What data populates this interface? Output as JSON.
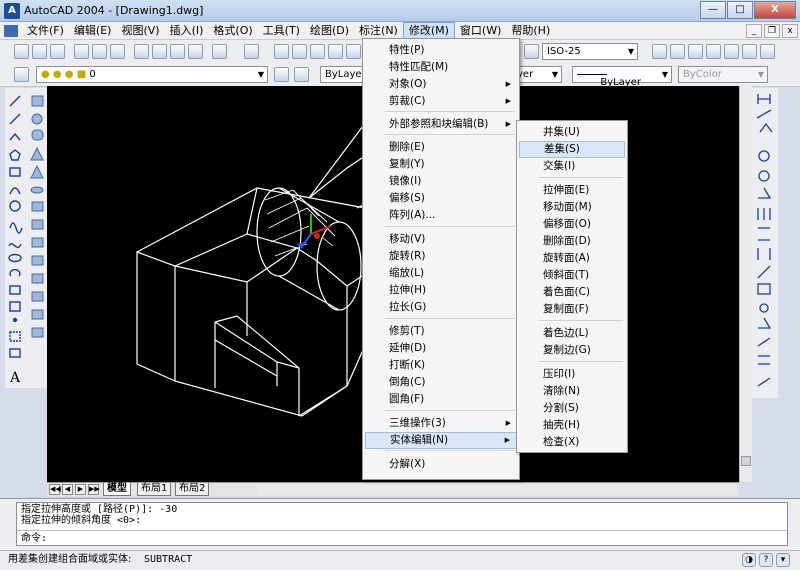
{
  "window": {
    "title": "AutoCAD 2004 - [Drawing1.dwg]",
    "app_icon": "autocad-icon",
    "minimize": "—",
    "maximize": "□",
    "close": "X"
  },
  "menubar": {
    "items": [
      "文件(F)",
      "编辑(E)",
      "视图(V)",
      "插入(I)",
      "格式(O)",
      "工具(T)",
      "绘图(D)",
      "标注(N)",
      "修改(M)",
      "窗口(W)",
      "帮助(H)"
    ],
    "active_index": 8
  },
  "toolbars": {
    "text_style": "ISO-25",
    "layer": "0",
    "color": "ByLayer",
    "linetype": "yer",
    "lineweight": "ByLayer",
    "plotstyle": "ByColor"
  },
  "modify_menu": {
    "items": [
      {
        "label": "特性(P)",
        "submenu": false
      },
      {
        "label": "特性匹配(M)",
        "submenu": false
      },
      {
        "label": "对象(O)",
        "submenu": true
      },
      {
        "label": "剪裁(C)",
        "submenu": true
      },
      {
        "label": "外部参照和块编辑(B)",
        "submenu": true
      },
      {
        "label": "删除(E)",
        "submenu": false
      },
      {
        "label": "复制(Y)",
        "submenu": false
      },
      {
        "label": "镜像(I)",
        "submenu": false
      },
      {
        "label": "偏移(S)",
        "submenu": false
      },
      {
        "label": "阵列(A)...",
        "submenu": false
      },
      {
        "label": "移动(V)",
        "submenu": false
      },
      {
        "label": "旋转(R)",
        "submenu": false
      },
      {
        "label": "缩放(L)",
        "submenu": false
      },
      {
        "label": "拉伸(H)",
        "submenu": false
      },
      {
        "label": "拉长(G)",
        "submenu": false
      },
      {
        "label": "修剪(T)",
        "submenu": false
      },
      {
        "label": "延伸(D)",
        "submenu": false
      },
      {
        "label": "打断(K)",
        "submenu": false
      },
      {
        "label": "倒角(C)",
        "submenu": false
      },
      {
        "label": "圆角(F)",
        "submenu": false
      },
      {
        "label": "三维操作(3)",
        "submenu": true
      },
      {
        "label": "实体编辑(N)",
        "submenu": true
      },
      {
        "label": "分解(X)",
        "submenu": false
      }
    ],
    "highlighted_index": 21
  },
  "solid_edit_menu": {
    "items": [
      "并集(U)",
      "差集(S)",
      "交集(I)",
      "拉伸面(E)",
      "移动面(M)",
      "偏移面(O)",
      "删除面(D)",
      "旋转面(A)",
      "倾斜面(T)",
      "着色面(C)",
      "复制面(F)",
      "着色边(L)",
      "复制边(G)",
      "压印(I)",
      "清除(N)",
      "分割(S)",
      "抽壳(H)",
      "检查(X)"
    ],
    "highlighted_index": 1
  },
  "layout_tabs": {
    "tabs": [
      "模型",
      "布局1",
      "布局2"
    ],
    "active_index": 0,
    "nav": [
      "◀◀",
      "◀",
      "▶",
      "▶▶"
    ]
  },
  "command_window": {
    "history": [
      "指定拉伸高度或 [路径(P)]: -30",
      "指定拉伸的倾斜角度 <0>:"
    ],
    "prompt": "命令:"
  },
  "status_bar": {
    "text": "用差集创建组合面域或实体:",
    "command": "SUBTRACT"
  },
  "colors": {
    "canvas": "#000000",
    "wireframe": "#ffffff",
    "menu_highlight": "#d8e6f6",
    "ucs_x": "#e02020",
    "ucs_y": "#20c020",
    "ucs_z": "#2060ff"
  }
}
